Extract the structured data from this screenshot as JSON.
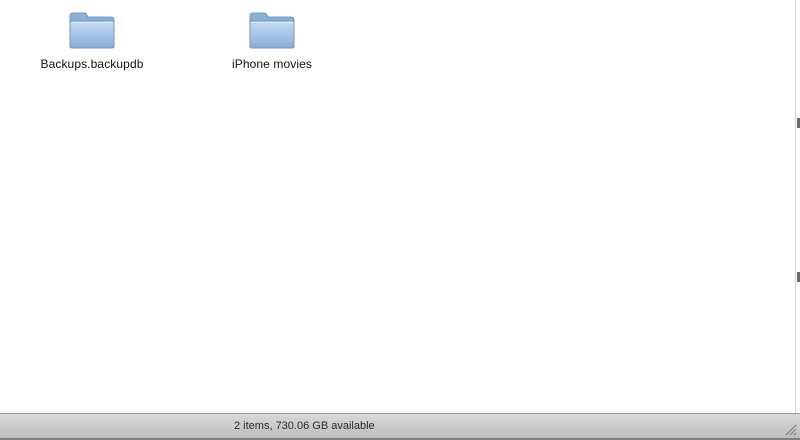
{
  "window": {
    "icons": [
      {
        "name": "Backups.backupdb",
        "icon": "folder-icon"
      },
      {
        "name": "iPhone movies",
        "icon": "folder-icon"
      }
    ]
  },
  "status_bar": {
    "text": "2 items, 730.06 GB available"
  },
  "colors": {
    "folder_light": "#a9c8e6",
    "folder_dark": "#7ea6cf",
    "status_bar": "#cfcfcf"
  }
}
